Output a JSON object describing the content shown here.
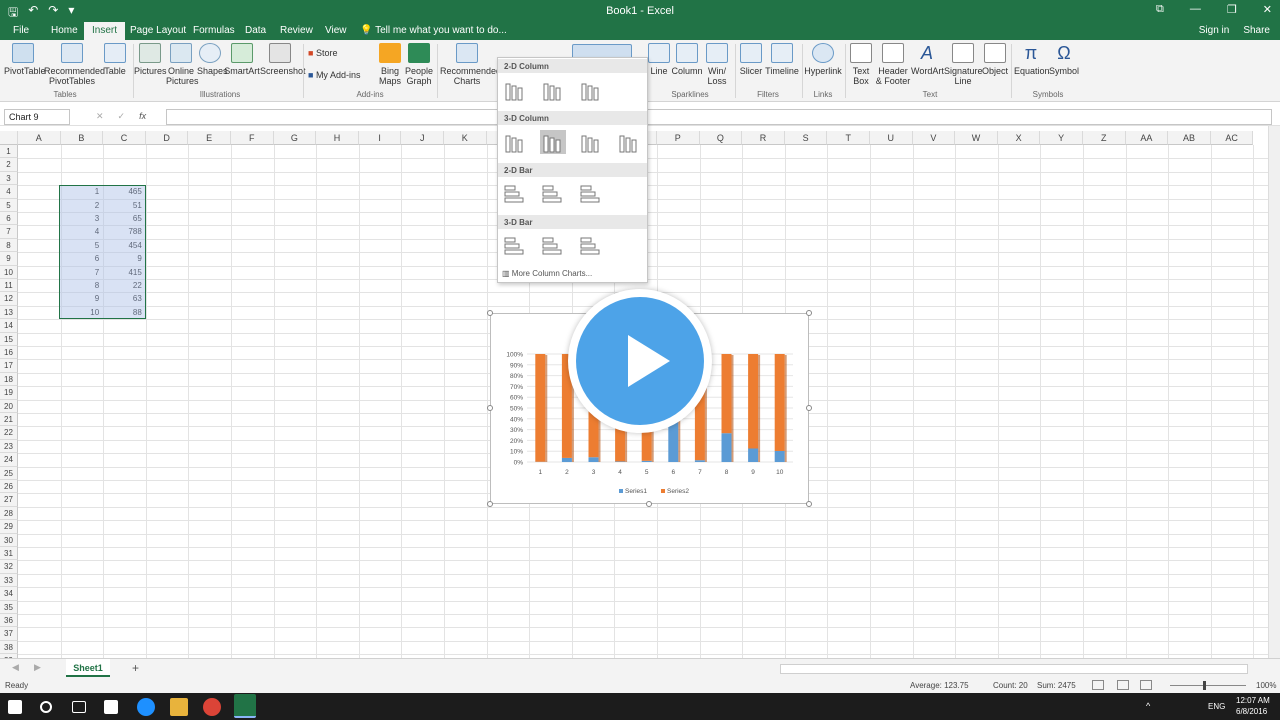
{
  "window": {
    "title": "Book1 - Excel",
    "qat": {
      "save": "🖫",
      "undo": "↶",
      "redo": "↷",
      "more": "▾"
    },
    "controls": {
      "ribbon_display": "⧉",
      "minimize": "—",
      "restore": "❐",
      "close": "✕"
    }
  },
  "tabs": [
    "File",
    "Home",
    "Insert",
    "Page Layout",
    "Formulas",
    "Data",
    "Review",
    "View"
  ],
  "tell_me": "Tell me what you want to do...",
  "sign_in": "Sign in",
  "share": "Share",
  "ribbon": {
    "buttons": {
      "pivottable": "PivotTable",
      "recommended_pivottables": "Recommended PivotTables",
      "table": "Table",
      "pictures": "Pictures",
      "online_pictures": "Online Pictures",
      "shapes": "Shapes",
      "smartart": "SmartArt",
      "screenshot": "Screenshot",
      "store": "Store",
      "my_addins": "My Add-ins",
      "bing_maps": "Bing Maps",
      "people_graph": "People Graph",
      "recommended_charts": "Recommended Charts",
      "line": "Line",
      "column": "Column",
      "win_loss": "Win/ Loss",
      "slicer": "Slicer",
      "timeline": "Timeline",
      "hyperlink": "Hyperlink",
      "text_box": "Text Box",
      "header_footer": "Header & Footer",
      "wordart": "WordArt",
      "signature_line": "Signature Line",
      "object": "Object",
      "equation": "Equation",
      "symbol": "Symbol"
    },
    "groups": {
      "tables": "Tables",
      "illustrations": "Illustrations",
      "addins": "Add-ins",
      "sparklines": "Sparklines",
      "filters": "Filters",
      "links": "Links",
      "text": "Text",
      "symbols": "Symbols"
    },
    "glyphs": {
      "equation": "π",
      "symbol": "Ω",
      "wordart": "A"
    }
  },
  "formula_bar": {
    "name_box": "Chart 9",
    "cancel": "✕",
    "enter": "✓",
    "fx": "fx",
    "value": ""
  },
  "columns": [
    "A",
    "B",
    "C",
    "D",
    "E",
    "F",
    "G",
    "H",
    "I",
    "J",
    "K",
    "L",
    "M",
    "N",
    "O",
    "P",
    "Q",
    "R",
    "S",
    "T",
    "U",
    "V",
    "W",
    "X",
    "Y",
    "Z",
    "AA",
    "AB",
    "AC"
  ],
  "rows": [
    "1",
    "2",
    "3",
    "4",
    "5",
    "6",
    "7",
    "8",
    "9",
    "10",
    "11",
    "12",
    "13",
    "14",
    "15",
    "16",
    "17",
    "18",
    "19",
    "20",
    "21",
    "22",
    "23",
    "24",
    "25",
    "26",
    "27",
    "28",
    "29",
    "30",
    "31",
    "32",
    "33",
    "34",
    "35",
    "36",
    "37",
    "38",
    "39"
  ],
  "cells": {
    "colB": [
      "1",
      "2",
      "3",
      "4",
      "5",
      "6",
      "7",
      "8",
      "9",
      "10"
    ],
    "colC": [
      "465",
      "51",
      "65",
      "788",
      "454",
      "9",
      "415",
      "22",
      "63",
      "88"
    ]
  },
  "dropdown": {
    "sections": [
      "2-D Column",
      "3-D Column",
      "2-D Bar",
      "3-D Bar"
    ],
    "more": "More Column Charts..."
  },
  "chart_data": {
    "type": "bar",
    "stacking": "percent",
    "categories": [
      "1",
      "2",
      "3",
      "4",
      "5",
      "6",
      "7",
      "8",
      "9",
      "10"
    ],
    "series": [
      {
        "name": "Series1",
        "color": "#5b9bd5",
        "values": [
          1,
          2,
          3,
          4,
          5,
          6,
          7,
          8,
          9,
          10
        ]
      },
      {
        "name": "Series2",
        "color": "#ed7d31",
        "values": [
          465,
          51,
          65,
          788,
          454,
          9,
          415,
          22,
          63,
          88
        ]
      }
    ],
    "ytick_labels": [
      "0%",
      "10%",
      "20%",
      "30%",
      "40%",
      "50%",
      "60%",
      "70%",
      "80%",
      "90%",
      "100%"
    ],
    "ylim": [
      0,
      1
    ],
    "legend": "bottom"
  },
  "sheet_tab": "Sheet1",
  "add_sheet": "+",
  "status": {
    "ready": "Ready",
    "average": "Average: 123.75",
    "count": "Count: 20",
    "sum": "Sum: 2475",
    "zoom": "100%"
  },
  "taskbar": {
    "lang": "ENG",
    "time": "12:07 AM",
    "date": "6/8/2016",
    "tray": "^"
  }
}
